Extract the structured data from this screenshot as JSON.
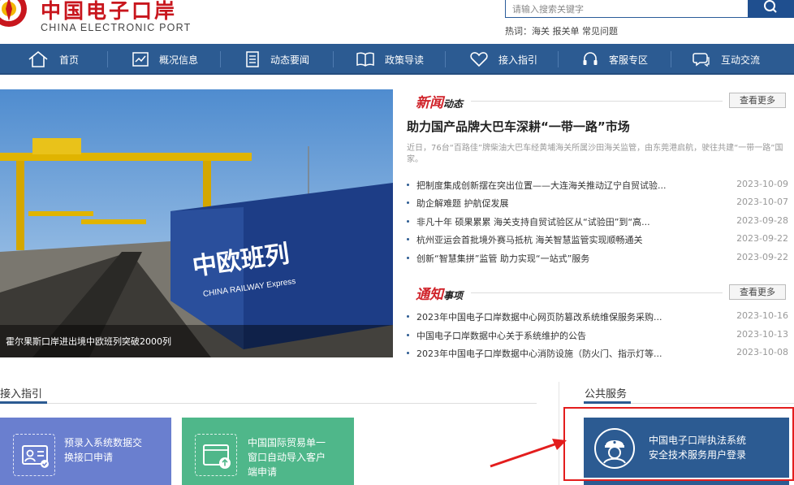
{
  "header": {
    "logo_cn": "中国电子口岸",
    "logo_en": "CHINA ELECTRONIC PORT",
    "search_placeholder": "请输入搜索关键字",
    "hot_label": "热词：",
    "hot_terms": [
      "海关",
      "报关单",
      "常见问题"
    ]
  },
  "nav": [
    {
      "label": "首页",
      "icon": "home-icon"
    },
    {
      "label": "概况信息",
      "icon": "chart-icon"
    },
    {
      "label": "动态要闻",
      "icon": "document-icon"
    },
    {
      "label": "政策导读",
      "icon": "book-icon"
    },
    {
      "label": "接入指引",
      "icon": "heart-icon"
    },
    {
      "label": "客服专区",
      "icon": "headset-icon"
    },
    {
      "label": "互动交流",
      "icon": "chat-icon"
    }
  ],
  "hero": {
    "caption": "霍尔果斯口岸进出境中欧班列突破2000列",
    "container_text": "中欧班列",
    "container_sub": "CHINA RAILWAY Express"
  },
  "news": {
    "title_big": "新闻",
    "title_small": "动态",
    "more": "查看更多",
    "headline": "助力国产品牌大巴车深耕“一带一路”市场",
    "summary": "近日，76台“百路佳”牌柴油大巴车经黄埔海关所属沙田海关监管，由东莞港启航，驶往共建“一带一路”国家。",
    "items": [
      {
        "text": "把制度集成创新摆在突出位置——大连海关推动辽宁自贸试验...",
        "date": "2023-10-09"
      },
      {
        "text": "助企解难题 护航促发展",
        "date": "2023-10-07"
      },
      {
        "text": "非凡十年 硕果累累 海关支持自贸试验区从“试验田”到“高...",
        "date": "2023-09-28"
      },
      {
        "text": "杭州亚运会首批境外赛马抵杭 海关智慧监管实现顺畅通关",
        "date": "2023-09-22"
      },
      {
        "text": "创新“智慧集拼”监管 助力实现“一站式”服务",
        "date": "2023-09-22"
      }
    ]
  },
  "notice": {
    "title_big": "通知",
    "title_small": "事项",
    "more": "查看更多",
    "items": [
      {
        "text": "2023年中国电子口岸数据中心网页防篡改系统维保服务采购...",
        "date": "2023-10-16"
      },
      {
        "text": "中国电子口岸数据中心关于系统维护的公告",
        "date": "2023-10-13"
      },
      {
        "text": "2023年中国电子口岸数据中心消防设施（防火门、指示灯等...",
        "date": "2023-10-08"
      }
    ]
  },
  "guide": {
    "title": "接入指引",
    "cards": [
      {
        "line1": "预录入系统数据交",
        "line2": "换接口申请",
        "line3": "",
        "color": "#6a7fcf",
        "icon": "id-card-icon"
      },
      {
        "line1": "中国国际贸易单一",
        "line2": "窗口自动导入客户",
        "line3": "端申请",
        "color": "#4fb78a",
        "icon": "upload-window-icon"
      }
    ]
  },
  "public": {
    "title": "公共服务",
    "card_line1": "中国电子口岸执法系统",
    "card_line2": "安全技术服务用户登录",
    "icon": "police-icon"
  },
  "colors": {
    "nav_bg": "#2c5b92",
    "brand_red": "#c8161d",
    "highlight_red": "#e31d1d"
  }
}
